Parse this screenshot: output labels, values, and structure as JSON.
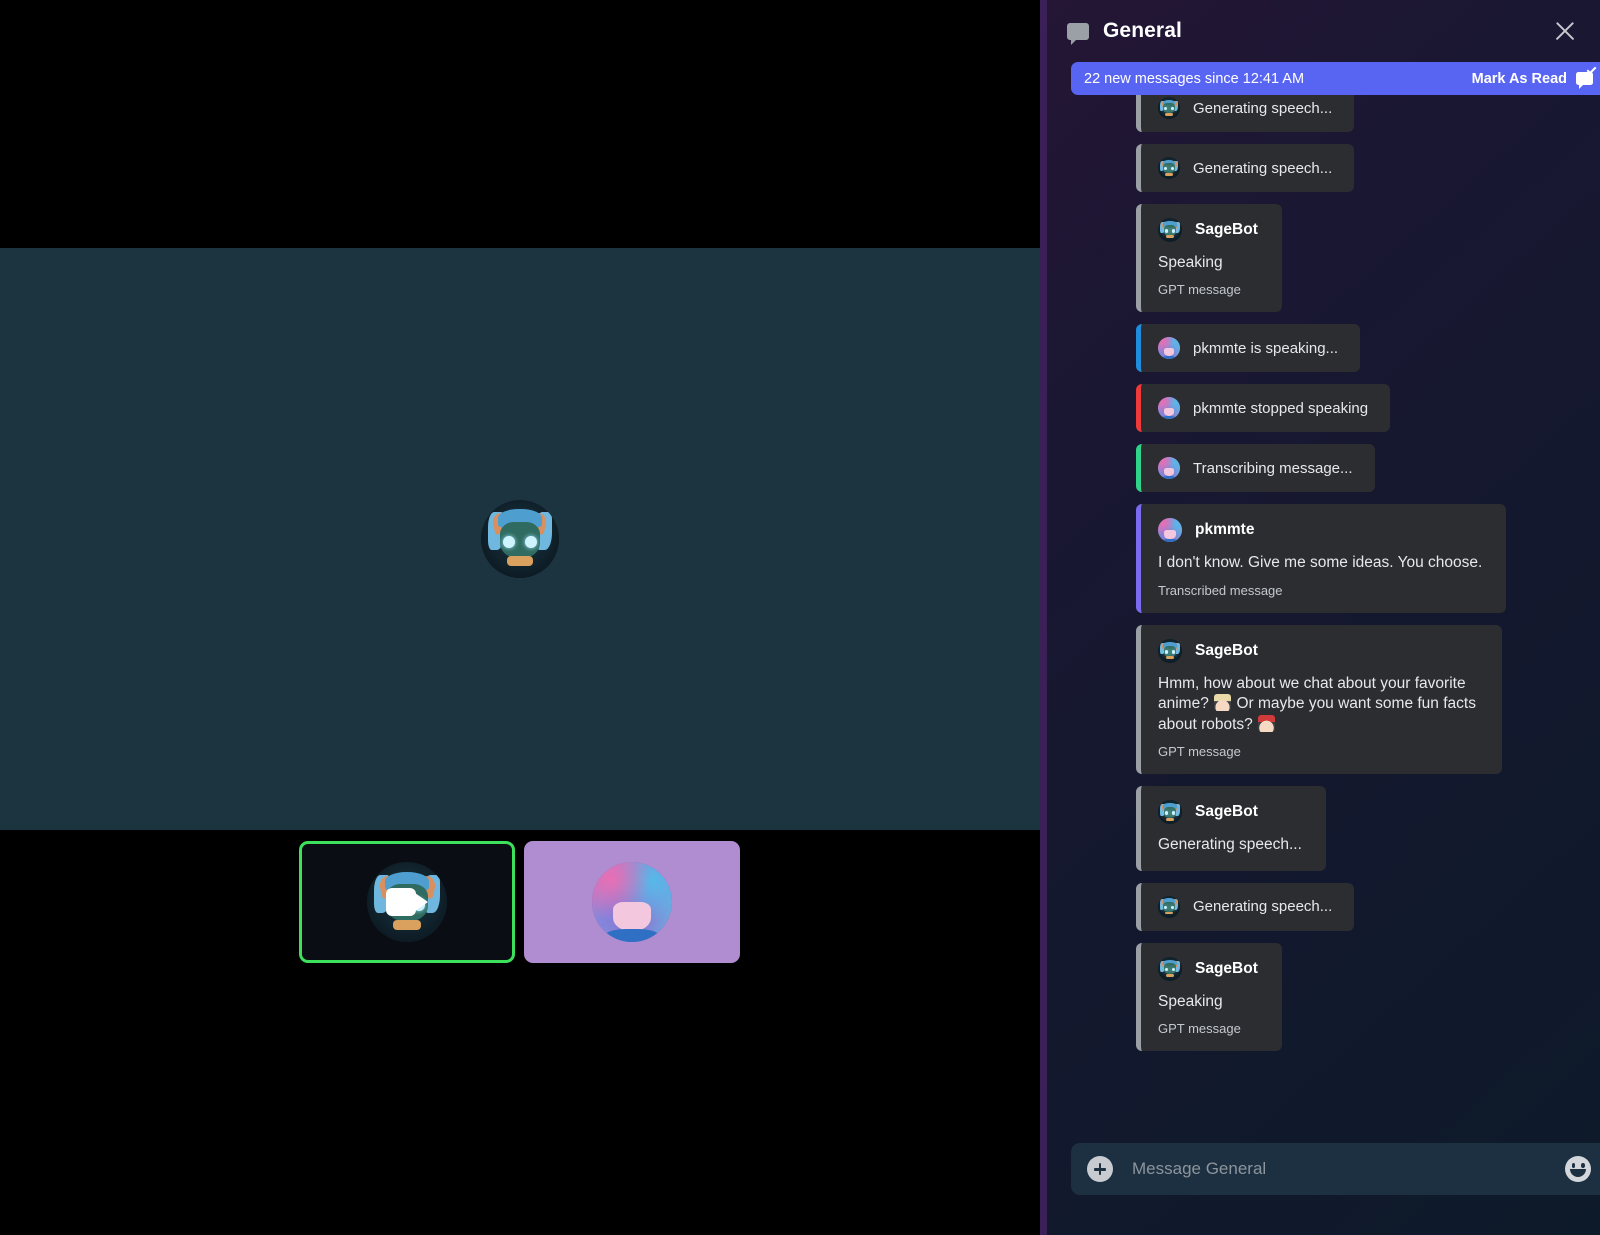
{
  "call": {
    "stage_participant": "SageBot",
    "tiles": [
      {
        "name": "sage-tile",
        "speaking": true,
        "icon": "video-camera-icon"
      },
      {
        "name": "pkmmte-tile",
        "speaking": false,
        "icon": ""
      }
    ]
  },
  "chat": {
    "header": {
      "icon": "speech-bubble-icon",
      "title": "General",
      "close_icon": "close-icon"
    },
    "banner": {
      "text": "22 new messages since 12:41 AM",
      "action_label": "Mark As Read",
      "action_icon": "mark-as-read-icon",
      "color": "#5865F2"
    },
    "messages": [
      {
        "type": "compact",
        "avatar": "sage",
        "accent": "grey",
        "text": "Generating speech..."
      },
      {
        "type": "compact",
        "avatar": "sage",
        "accent": "grey",
        "text": "Generating speech..."
      },
      {
        "type": "full",
        "avatar": "sage",
        "accent": "grey",
        "author": "SageBot",
        "body": "Speaking",
        "footer": "GPT message"
      },
      {
        "type": "compact",
        "avatar": "pk",
        "accent": "blue",
        "text": "pkmmte is speaking..."
      },
      {
        "type": "compact",
        "avatar": "pk",
        "accent": "red",
        "text": "pkmmte stopped speaking"
      },
      {
        "type": "compact",
        "avatar": "pk",
        "accent": "green",
        "text": "Transcribing message..."
      },
      {
        "type": "full",
        "avatar": "pk",
        "accent": "purple",
        "author": "pkmmte",
        "body": "I don't know. Give me some ideas. You choose.",
        "footer": "Transcribed message"
      },
      {
        "type": "full",
        "avatar": "sage",
        "accent": "grey",
        "author": "SageBot",
        "body_parts": [
          "Hmm, how about we chat about your favorite anime? ",
          "anime-emoji",
          " Or maybe you want some fun facts about robots? ",
          "anime-red-emoji"
        ],
        "footer": "GPT message",
        "wide": true
      },
      {
        "type": "full",
        "avatar": "sage",
        "accent": "grey",
        "author": "SageBot",
        "body": "Generating speech..."
      },
      {
        "type": "compact",
        "avatar": "sage",
        "accent": "grey",
        "text": "Generating speech..."
      },
      {
        "type": "full",
        "avatar": "sage",
        "accent": "grey",
        "author": "SageBot",
        "body": "Speaking",
        "footer": "GPT message"
      }
    ],
    "input": {
      "placeholder": "Message General",
      "value": "",
      "attach_icon": "plus-circle-icon",
      "emoji_icon": "smiley-face-icon"
    }
  },
  "colors": {
    "accent_blurple": "#5865F2",
    "speaking_green": "#3CE05A",
    "stage_teal": "#1B3440",
    "bubble": "#2B2D31"
  }
}
